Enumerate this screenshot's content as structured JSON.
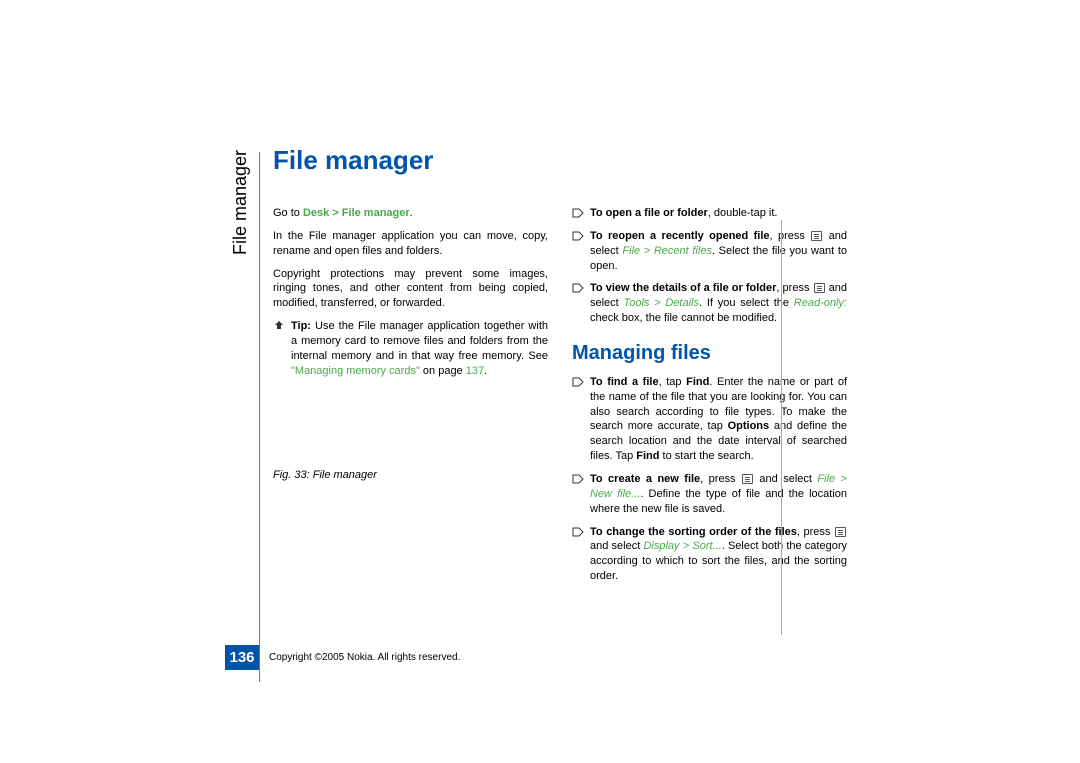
{
  "side_label": "File manager",
  "title": "File manager",
  "subtitle": "Managing files",
  "page_number": "136",
  "copyright": "Copyright ©2005 Nokia. All rights reserved.",
  "left_col": {
    "goto_prefix": "Go to ",
    "goto_path": "Desk > File manager",
    "goto_suffix": ".",
    "p1": "In the File manager application you can move, copy, rename and open files and folders.",
    "p2": "Copyright protections may prevent some images, ringing tones, and other content from being copied, modified, transferred, or forwarded.",
    "tip_label": "Tip:",
    "tip_text_a": " Use the File manager application together with a memory card to remove files and folders from the internal memory and in that way free memory. See ",
    "tip_link": "\"Managing memory cards\"",
    "tip_text_b": " on page ",
    "tip_page": "137",
    "tip_suffix": ".",
    "fig_caption": "Fig. 33: File manager"
  },
  "right_col": {
    "t1_a": "To open a file or folder",
    "t1_b": ", double-tap it.",
    "t2_a": "To reopen a recently opened file",
    "t2_b": ", press ",
    "t2_c": " and select ",
    "t2_path": "File > Recent files",
    "t2_d": ". Select the file you want to open.",
    "t3_a": "To view the details of a file or folder",
    "t3_b": ", press ",
    "t3_c": " and select ",
    "t3_path": "Tools > Details",
    "t3_d": ". If you select the ",
    "t3_ro": "Read-only:",
    "t3_e": " check box, the file cannot be modified.",
    "t4_a": "To find a file",
    "t4_b": ", tap ",
    "t4_find1": "Find",
    "t4_c": ". Enter the name or part of the name of the file that you are looking for. You can also search according to file types. To make the search more accurate, tap ",
    "t4_options": "Options",
    "t4_d": " and define the search location and the date interval of searched files. Tap ",
    "t4_find2": "Find",
    "t4_e": " to start the search.",
    "t5_a": "To create a new file",
    "t5_b": ", press ",
    "t5_c": " and select ",
    "t5_path": "File > New file...",
    "t5_d": ". Define the type of file and the location where the new file is saved.",
    "t6_a": "To change the sorting order of the files",
    "t6_b": ", press ",
    "t6_c": " and select ",
    "t6_path": "Display > Sort...",
    "t6_d": ". Select both the category according to which to sort the files, and the sorting order."
  }
}
